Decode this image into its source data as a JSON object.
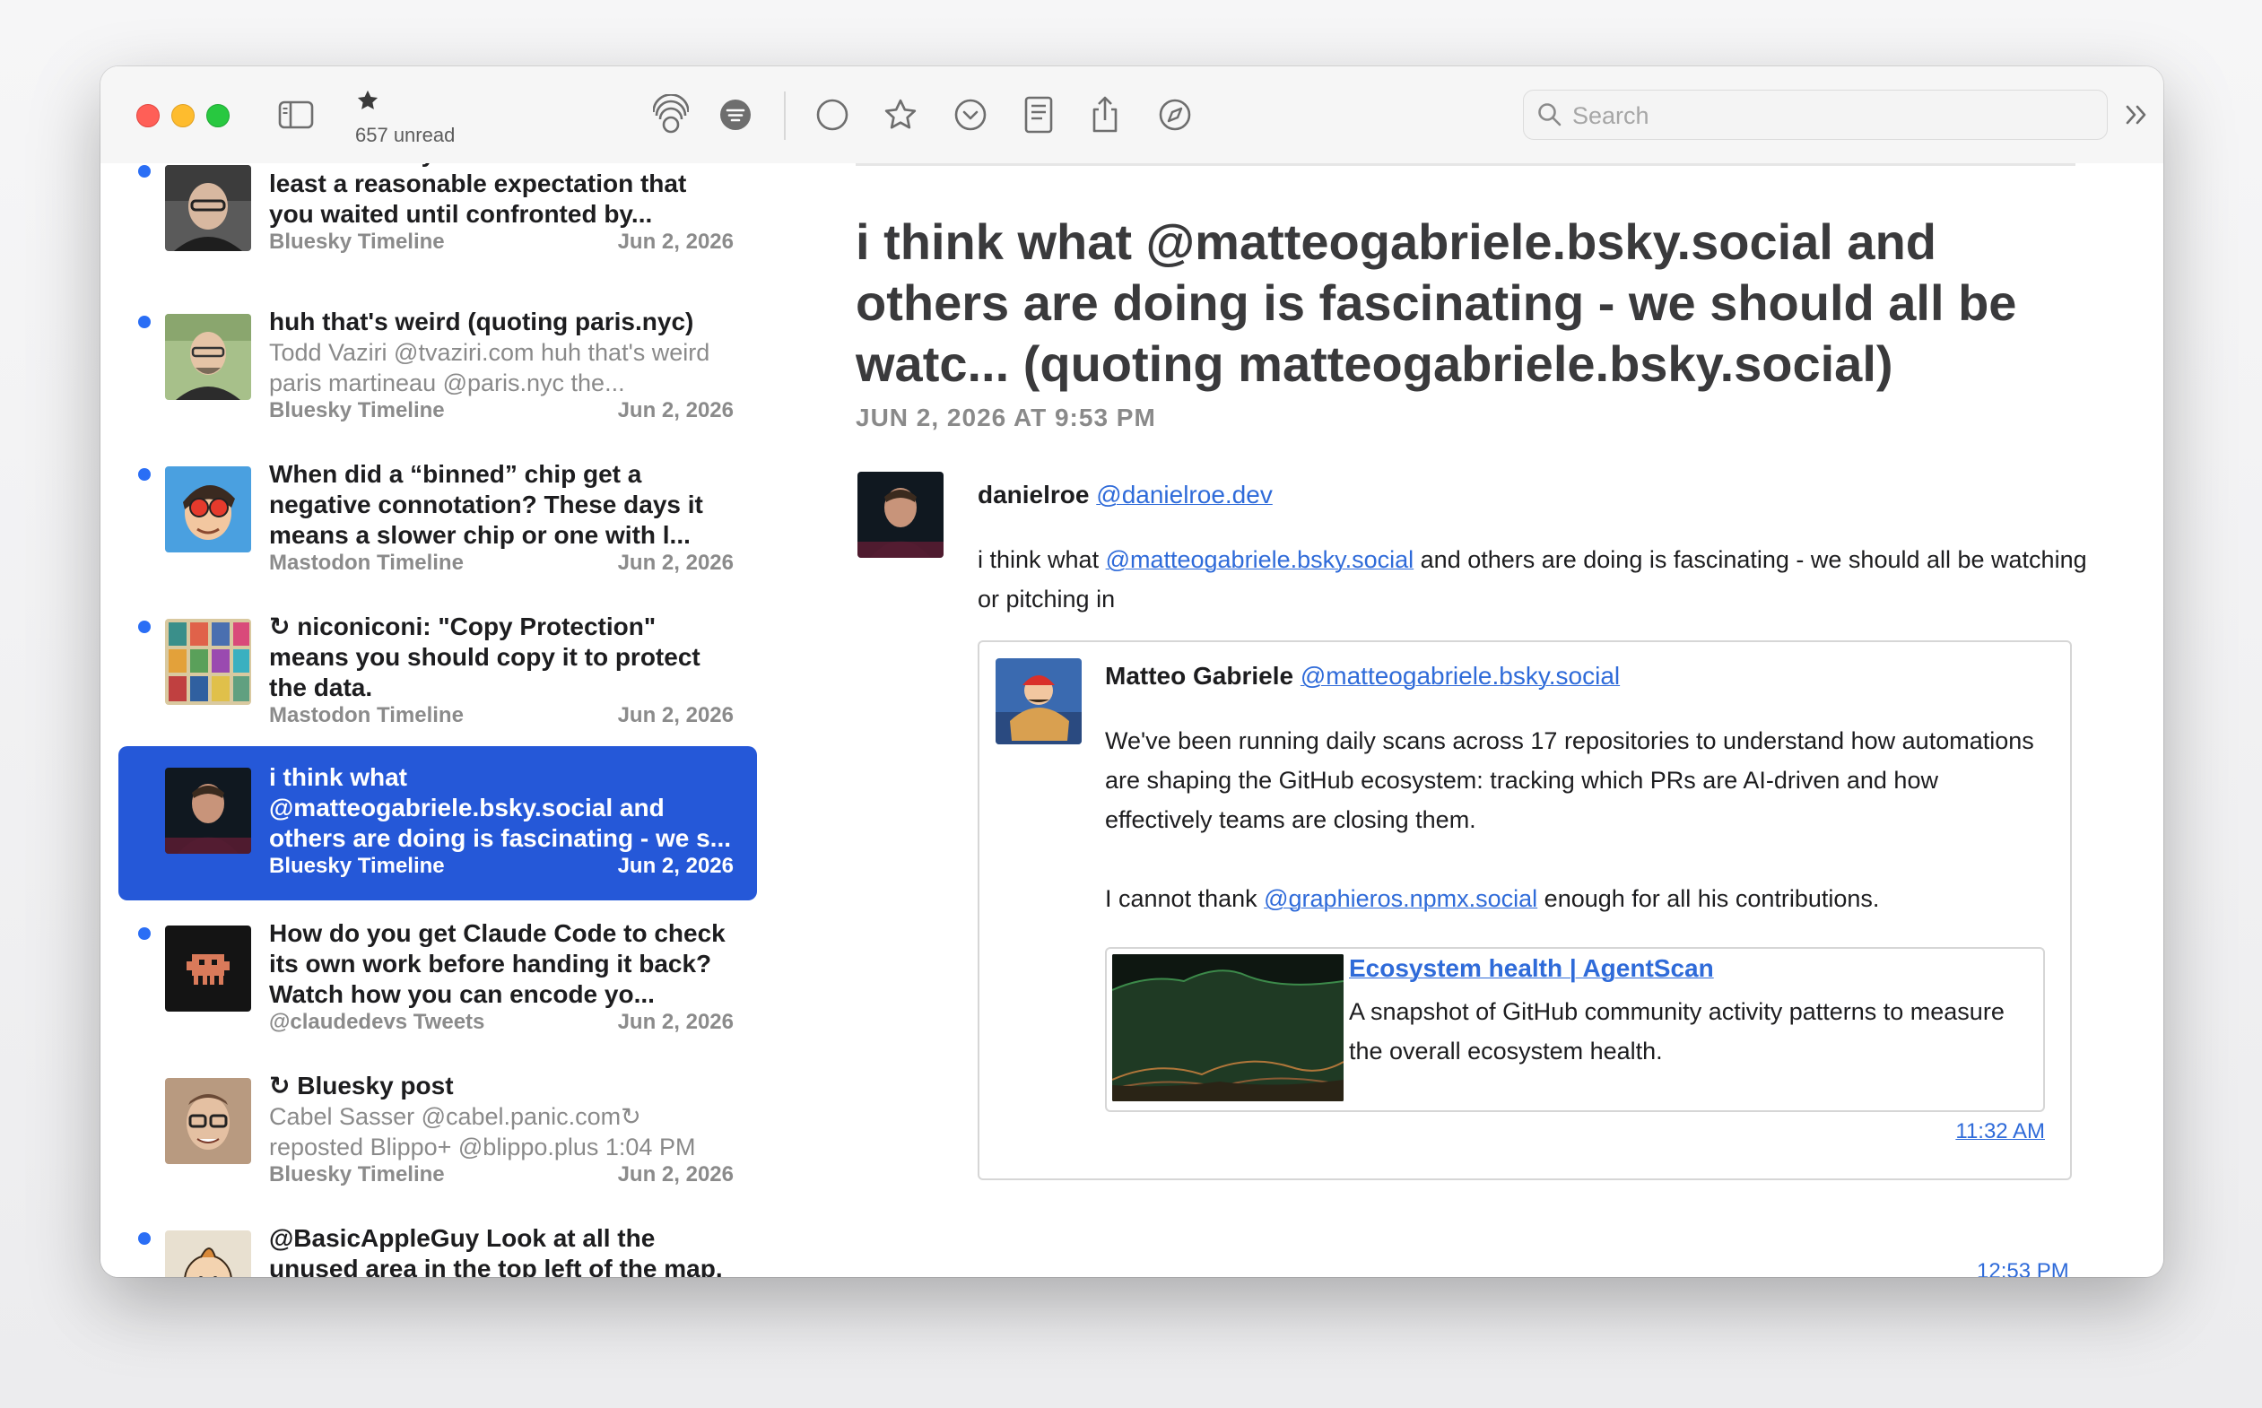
{
  "toolbar": {
    "unread_label": "657 unread",
    "search_placeholder": "Search"
  },
  "timeline": [
    {
      "title": "I miss the days when there was at least a reasonable expectation that you waited until confronted by...",
      "summary": "",
      "source": "Bluesky Timeline",
      "date": "Jun 2, 2026",
      "unread": true,
      "selected": false
    },
    {
      "title": "huh that's weird (quoting paris.nyc)",
      "summary": "Todd Vaziri @tvaziri.com huh that's weird paris martineau @paris.nyc the...",
      "source": "Bluesky Timeline",
      "date": "Jun 2, 2026",
      "unread": true,
      "selected": false
    },
    {
      "title": "When did a “binned” chip get a negative connotation? These days it means a slower chip or one with l...",
      "summary": "",
      "source": "Mastodon Timeline",
      "date": "Jun 2, 2026",
      "unread": true,
      "selected": false
    },
    {
      "repost_glyph": "↻",
      "title": "niconiconi: \"Copy Protection\" means you should copy it to protect the data.",
      "summary": "",
      "source": "Mastodon Timeline",
      "date": "Jun 2, 2026",
      "unread": true,
      "selected": false
    },
    {
      "title": "i think what @matteogabriele.bsky.social and others are doing is fascinating - we s...",
      "summary": "",
      "source": "Bluesky Timeline",
      "date": "Jun 2, 2026",
      "unread": false,
      "selected": true
    },
    {
      "title": "How do you get Claude Code to check its own work before handing it back? Watch how you can encode yo...",
      "summary": "",
      "source": "@claudedevs Tweets",
      "date": "Jun 2, 2026",
      "unread": true,
      "selected": false
    },
    {
      "repost_glyph": "↻",
      "title": "Bluesky post",
      "summary": "Cabel Sasser @cabel.panic.com↻ reposted Blippo+ @blippo.plus 1:04 PM",
      "source": "Bluesky Timeline",
      "date": "Jun 2, 2026",
      "unread": false,
      "selected": false
    },
    {
      "title": "@BasicAppleGuy Look at all the unused area in the top left of the map.",
      "summary": "",
      "source": "",
      "date": "",
      "unread": true,
      "selected": false
    }
  ],
  "article": {
    "title": "i think what @matteogabriele.bsky.social and others are doing is fascinating - we should all be watc... (quoting matteogabriele.bsky.social)",
    "date": "JUN 2, 2026 AT 9:53 PM",
    "author_name": "danielroe",
    "author_handle": "@danielroe.dev",
    "body_before": "i think what ",
    "body_mention": "@matteogabriele.bsky.social",
    "body_after": " and others are doing is fascinating - we should all be watching or pitching in",
    "quote": {
      "author_name": "Matteo Gabriele",
      "author_handle": "@matteogabriele.bsky.social",
      "paragraph1": "We've been running daily scans across 17 repositories to understand how automations are shaping the GitHub ecosystem: tracking which PRs are AI-driven and how effectively teams are closing them.",
      "paragraph2_before": "I cannot thank ",
      "paragraph2_mention": "@graphieros.npmx.social",
      "paragraph2_after": " enough for all his contributions.",
      "card_title": "Ecosystem health | AgentScan",
      "card_description": "A snapshot of GitHub community activity patterns to measure the overall ecosystem health.",
      "time": "11:32 AM"
    },
    "time": "12:53 PM"
  },
  "colors": {
    "accent": "#2558d8",
    "link": "#2f6bd9",
    "unread_dot": "#2a6ef5"
  }
}
